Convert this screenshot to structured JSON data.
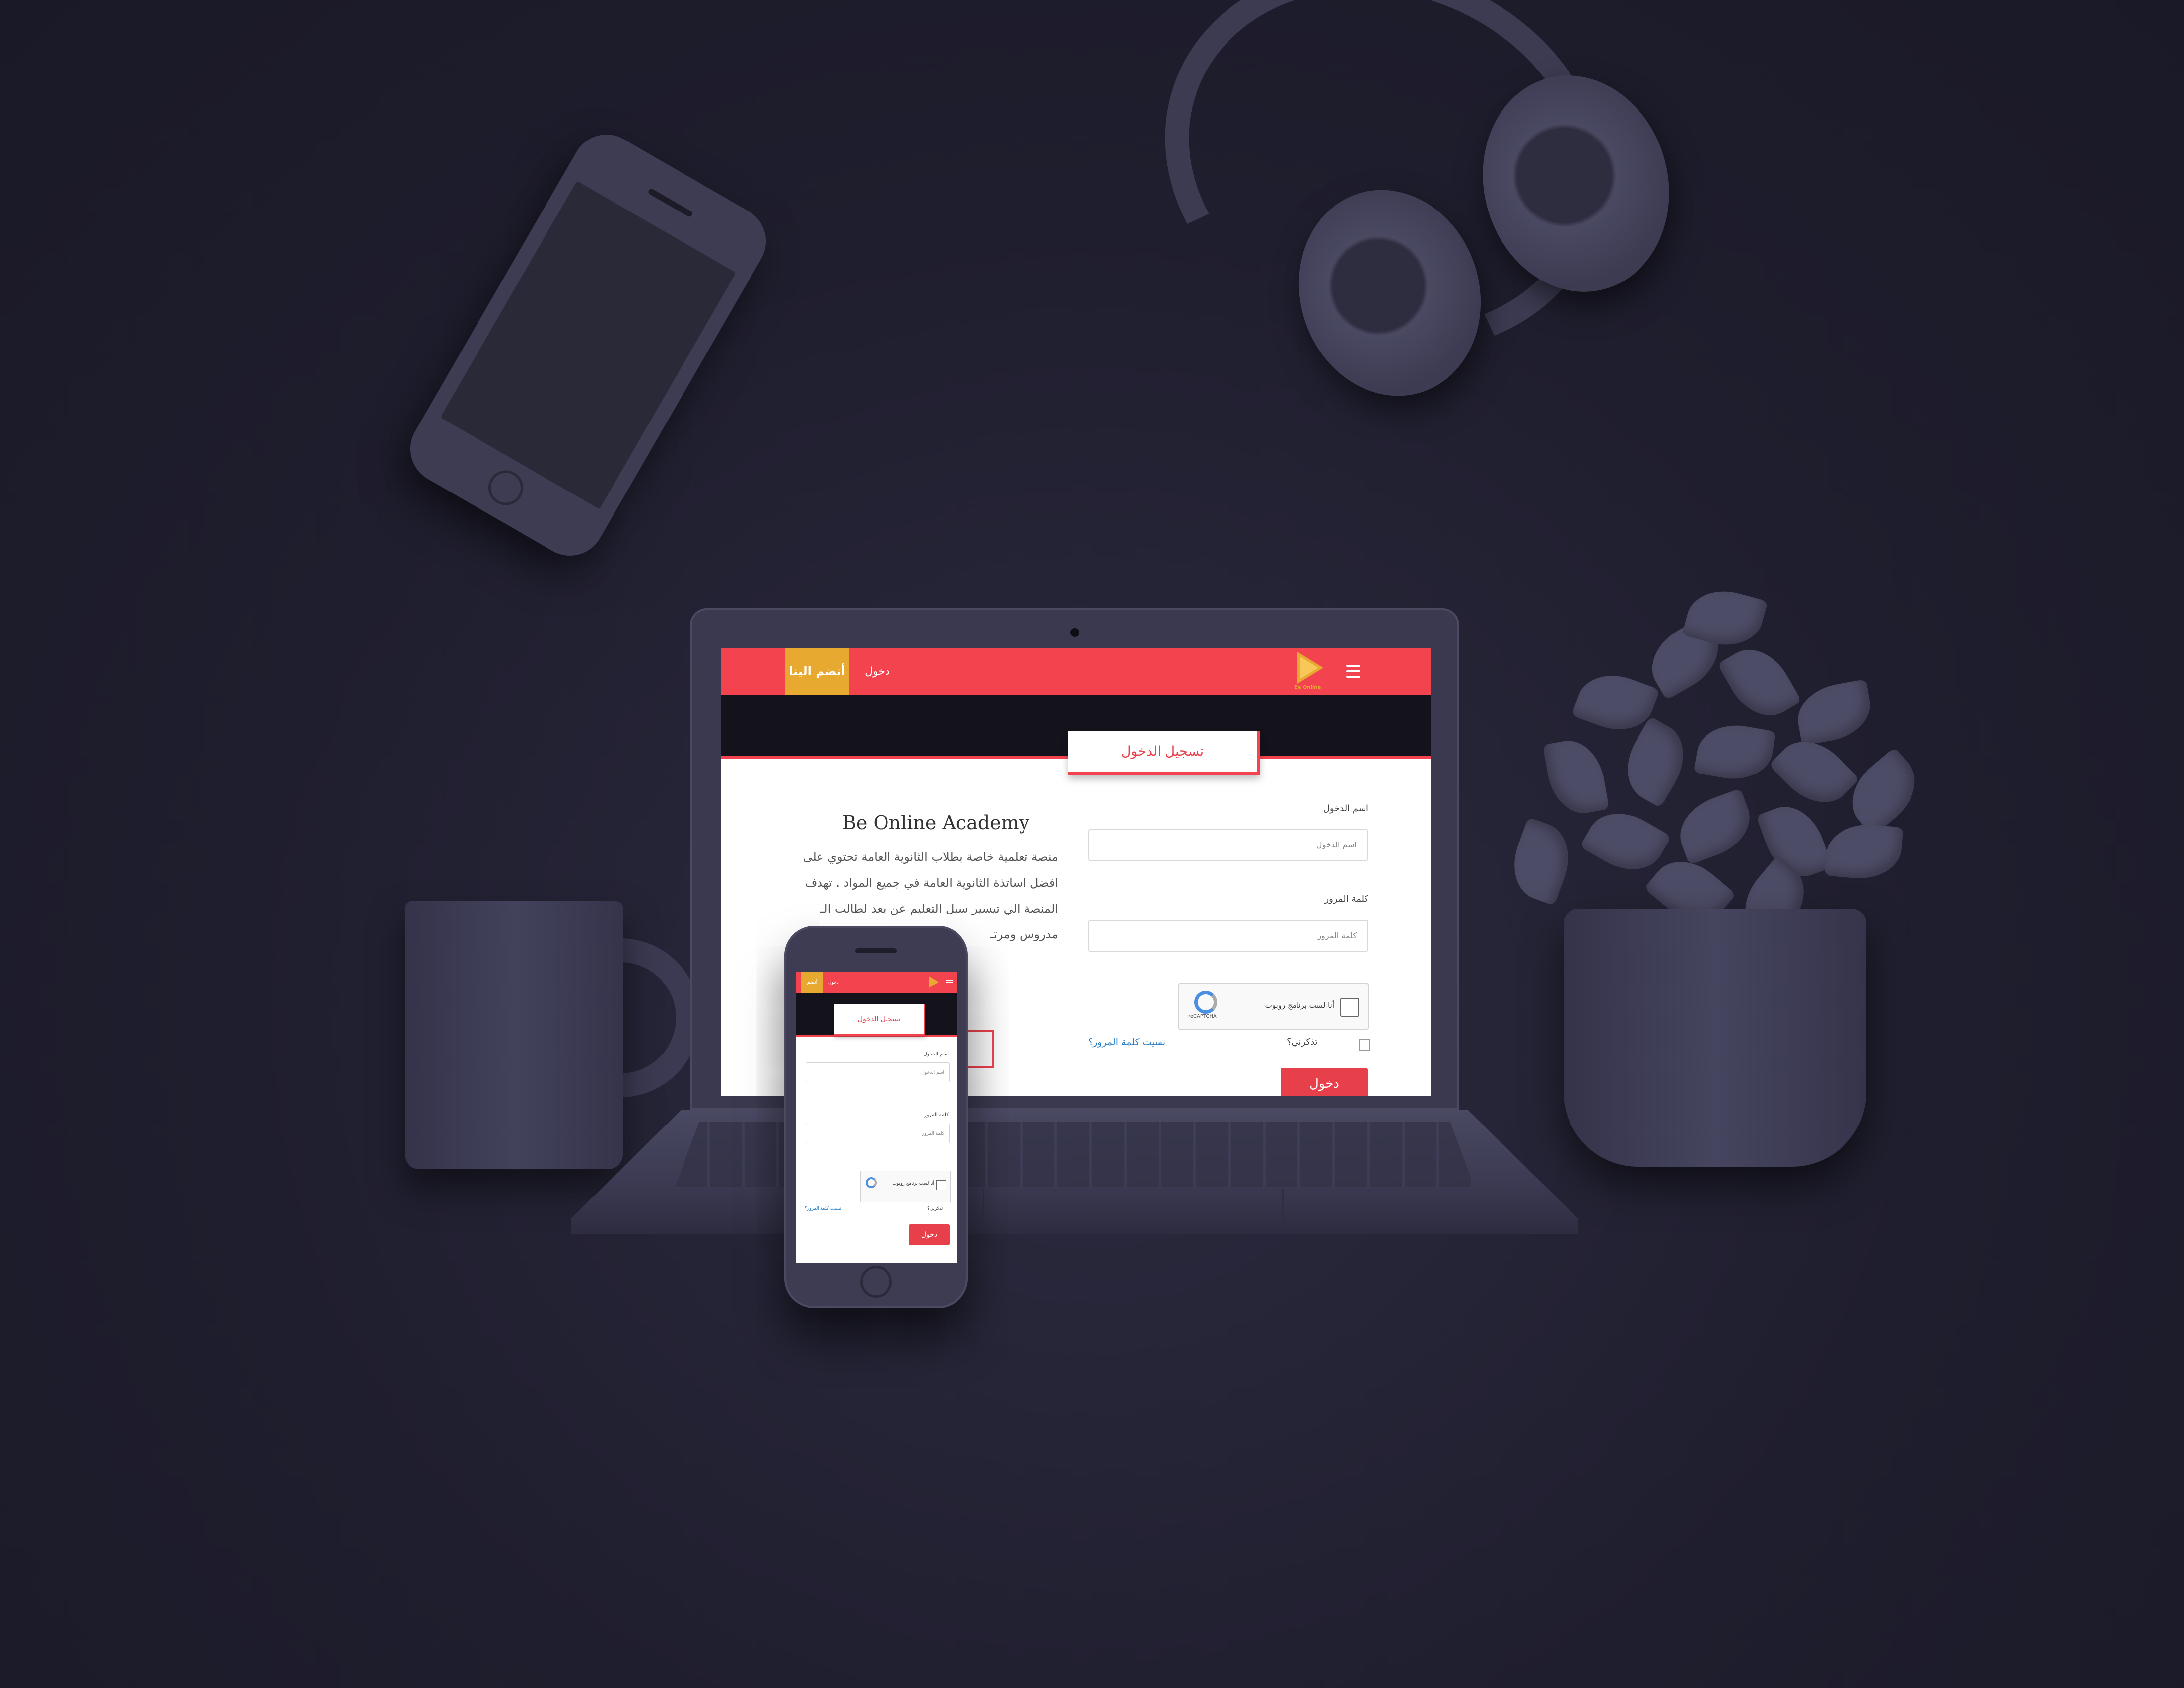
{
  "laptop_page": {
    "nav": {
      "join_label": "أنضم الينا",
      "login_label": "دخول",
      "logo_text": "Be Online"
    },
    "tab_title": "تسجيل الدخول",
    "form": {
      "username_label": "اسم الدخول",
      "username_placeholder": "اسم الدخول",
      "password_label": "كلمة المرور",
      "password_placeholder": "كلمة المرور",
      "captcha_text": "أنا لست برنامج روبوت",
      "captcha_brand": "reCAPTCHA",
      "remember_label": "تذكرني؟",
      "forgot_label": "نسيت كلمة المرور؟",
      "submit_label": "دخول"
    },
    "about": {
      "title": "Be Online Academy",
      "paragraph": "منصة تعلمية خاصة بطلاب الثانوية العامة تحتوي على افضل اساتذة الثانوية العامة في جميع المواد . تهدف المنصة الي تيسير سبل التعليم عن بعد لطالب الـ مدروس ومرتـ"
    }
  },
  "phone_page": {
    "nav": {
      "join_label": "أنضم",
      "login_label": "دخول"
    },
    "tab_title": "تسجيل الدخول",
    "form": {
      "username_label": "اسم الدخول",
      "username_placeholder": "اسم الدخول",
      "password_label": "كلمة المرور",
      "password_placeholder": "كلمة المرور",
      "captcha_text": "أنا لست برنامج روبوت",
      "remember_label": "تذكرني؟",
      "forgot_label": "نسيت كلمة المرور؟",
      "submit_label": "دخول"
    }
  },
  "colors": {
    "nav_red": "#f2434f",
    "accent_yellow": "#e8a931",
    "button_red": "#e8404b",
    "link_blue": "#2a7fc7",
    "background": "#1f1e2e"
  },
  "icons": [
    "menu-icon",
    "logo-play-icon",
    "recaptcha-icon",
    "checkbox-icon"
  ]
}
